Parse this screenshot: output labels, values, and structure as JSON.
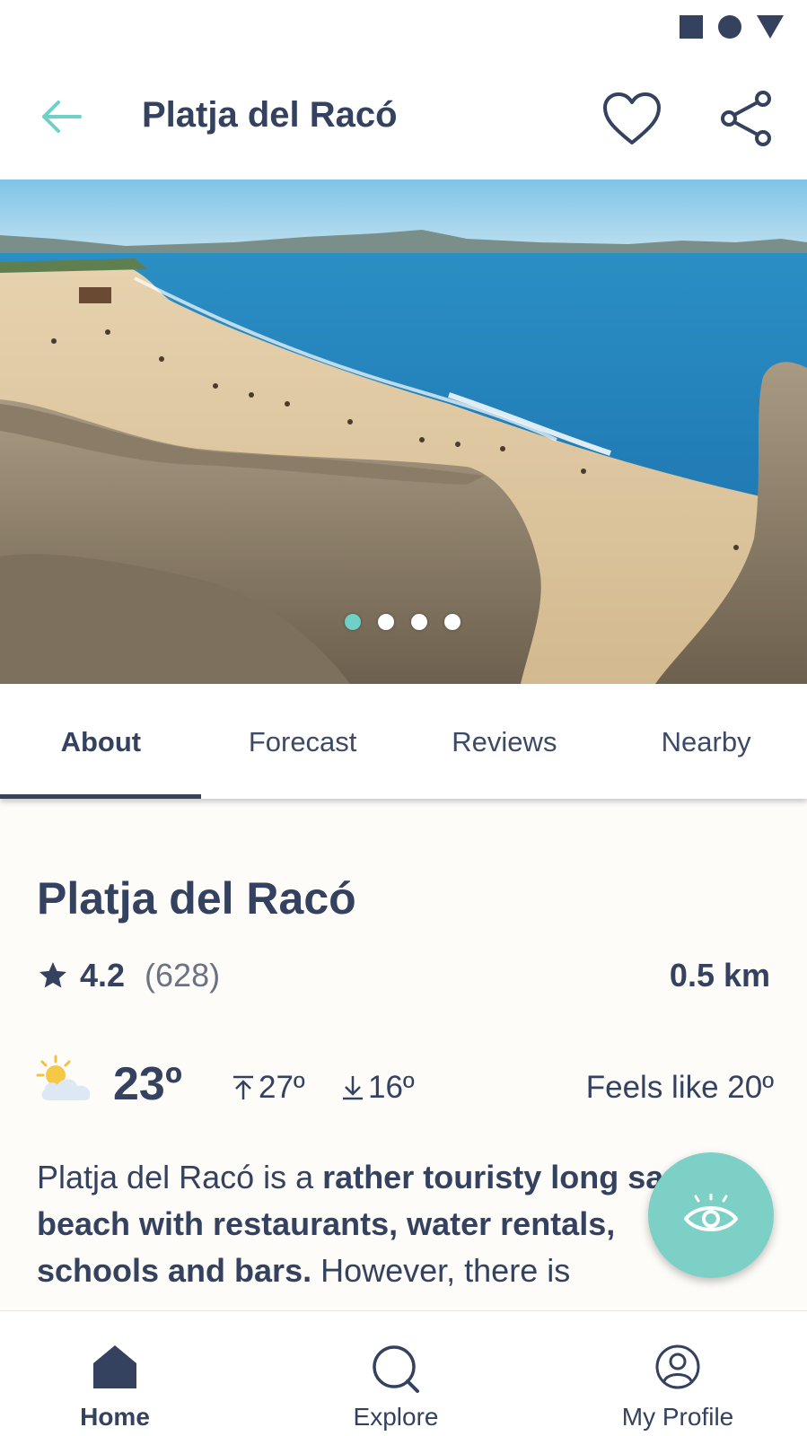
{
  "status_bar": {
    "icons": [
      "square-icon",
      "circle-icon",
      "triangle-icon"
    ]
  },
  "header": {
    "title": "Platja del Racó",
    "back_icon": "arrow-left-icon",
    "favorite_icon": "heart-icon",
    "share_icon": "share-icon"
  },
  "gallery": {
    "image": "beach-photo",
    "dots": 4,
    "active_dot": 0
  },
  "tabs": [
    {
      "label": "About",
      "active": true
    },
    {
      "label": "Forecast",
      "active": false
    },
    {
      "label": "Reviews",
      "active": false
    },
    {
      "label": "Nearby",
      "active": false
    }
  ],
  "about": {
    "title": "Platja del Racó",
    "rating": "4.2",
    "rating_count": "(628)",
    "distance": "0.5 km",
    "weather": {
      "icon": "partly-cloudy-icon",
      "temp": "23º",
      "high": "27º",
      "low": "16º",
      "feels_like": "Feels like 20º"
    },
    "description": {
      "part1": "Platja del Racó is a ",
      "bold": "rather touristy long sandy beach with restaurants, water rentals, schools and bars.",
      "part2": " However, there is"
    }
  },
  "fab": {
    "icon": "eye-icon"
  },
  "bottom_nav": [
    {
      "label": "Home",
      "icon": "home-icon",
      "active": true
    },
    {
      "label": "Explore",
      "icon": "search-icon",
      "active": false
    },
    {
      "label": "My Profile",
      "icon": "profile-icon",
      "active": false
    }
  ],
  "colors": {
    "primary": "#34425f",
    "accent": "#6fd0c8",
    "background": "#fdfcf9"
  }
}
